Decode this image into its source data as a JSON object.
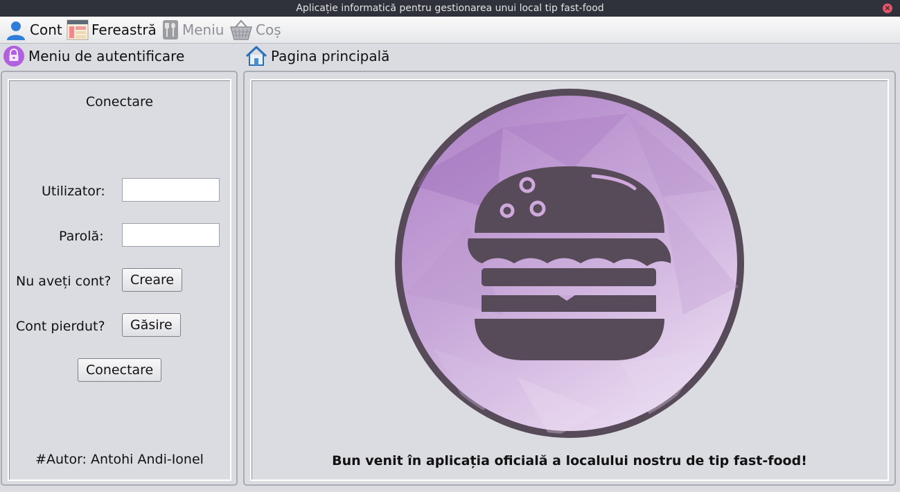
{
  "window": {
    "title": "Aplicație informatică pentru gestionarea unui local tip fast-food",
    "close_symbol": "×"
  },
  "menubar": {
    "items": [
      {
        "label": "Cont",
        "icon": "user-icon",
        "enabled": true
      },
      {
        "label": "Fereastră",
        "icon": "window-icon",
        "enabled": true
      },
      {
        "label": "Meniu",
        "icon": "cutlery-icon",
        "enabled": false
      },
      {
        "label": "Coș",
        "icon": "basket-icon",
        "enabled": false
      }
    ]
  },
  "login_panel": {
    "header": "Meniu de autentificare",
    "header_icon": "lock-icon",
    "title": "Conectare",
    "user_label": "Utilizator:",
    "user_value": "",
    "password_label": "Parolă:",
    "password_value": "",
    "no_account_label": "Nu aveți cont?",
    "create_button": "Creare",
    "lost_account_label": "Cont pierdut?",
    "find_button": "Găsire",
    "connect_button": "Conectare",
    "author": "#Autor: Antohi Andi-Ionel"
  },
  "main_panel": {
    "header": "Pagina principală",
    "header_icon": "home-icon",
    "logo_icon": "burger-logo-icon",
    "welcome": "Bun venit în aplicația oficială a localului nostru de tip fast-food!"
  },
  "colors": {
    "titlebar": "#2f323a",
    "close": "#e0566a",
    "logo_ring": "#574a59",
    "logo_fill": "#c9a9d8",
    "burger": "#574a59"
  }
}
